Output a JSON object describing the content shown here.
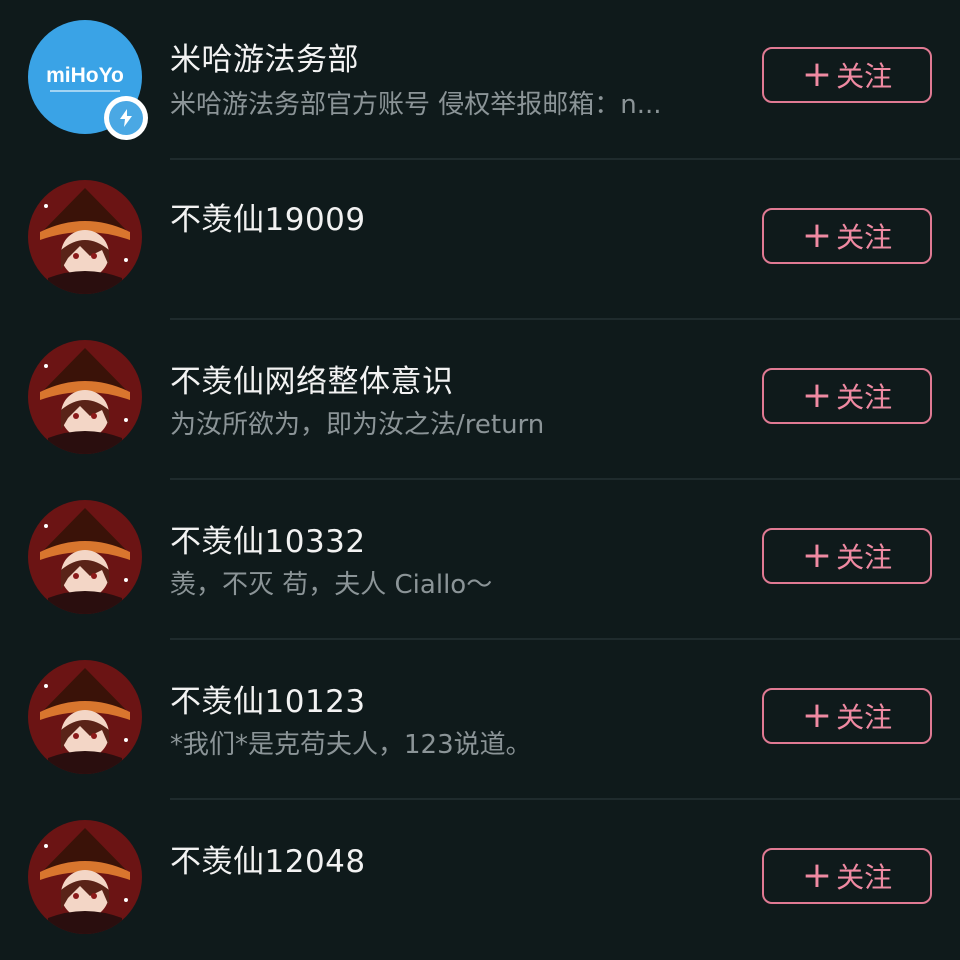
{
  "users": [
    {
      "name": "米哈游法务部",
      "bio": "米哈游法务部官方账号 侵权举报邮箱：n...",
      "follow_label": "关注",
      "avatar_text": "miHoYo",
      "verified": true
    },
    {
      "name": "不羡仙19009",
      "bio": "",
      "follow_label": "关注"
    },
    {
      "name": "不羡仙网络整体意识",
      "bio": "为汝所欲为，即为汝之法/return",
      "follow_label": "关注"
    },
    {
      "name": "不羡仙10332",
      "bio": "羡，不灭 苟，夫人 Ciallo～",
      "follow_label": "关注"
    },
    {
      "name": "不羡仙10123",
      "bio": "*我们*是克苟夫人，123说道。",
      "follow_label": "关注"
    },
    {
      "name": "不羡仙12048",
      "bio": "",
      "follow_label": "关注"
    }
  ],
  "colors": {
    "background": "#0f1a1b",
    "accent": "#e07a93",
    "name_text": "#f2f2f2",
    "bio_text": "#8b9497",
    "mihoyo_blue": "#3aa3e6"
  },
  "icons": {
    "follow_plus": "plus-icon",
    "verified": "lightning-icon"
  }
}
